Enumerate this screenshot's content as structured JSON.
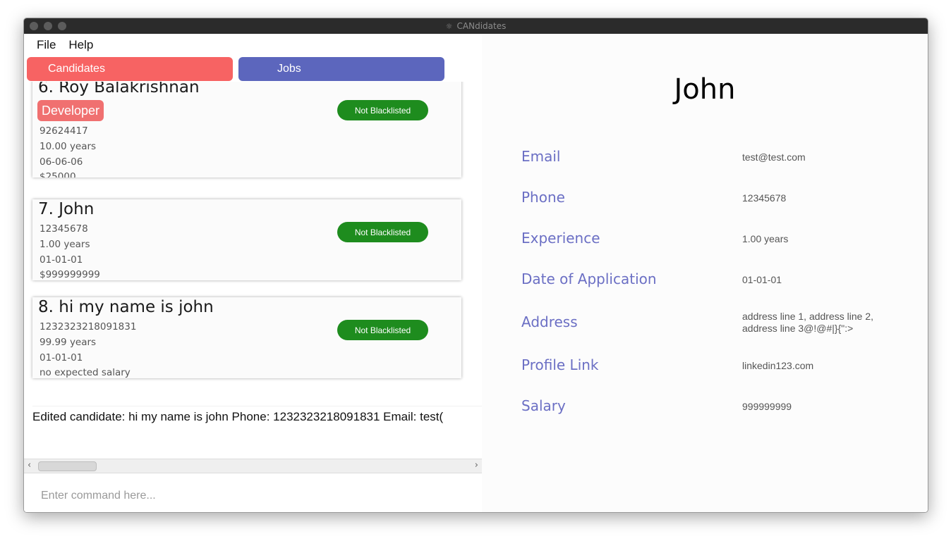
{
  "window": {
    "title": "CANdidates"
  },
  "menu": {
    "file": "File",
    "help": "Help"
  },
  "tabs": {
    "candidates": "Candidates",
    "jobs": "Jobs"
  },
  "candidates": [
    {
      "index": "6.",
      "name": "Roy Balakrishnan",
      "tag": "Developer",
      "phone": "92624417",
      "experience": "10.00 years",
      "date": "06-06-06",
      "salary": "$25000",
      "status": "Not Blacklisted"
    },
    {
      "index": "7.",
      "name": "John",
      "phone": "12345678",
      "experience": "1.00 years",
      "date": "01-01-01",
      "salary": "$999999999",
      "status": "Not Blacklisted"
    },
    {
      "index": "8.",
      "name": "hi my name is john",
      "phone": "1232323218091831",
      "experience": "99.99 years",
      "date": "01-01-01",
      "salary": "no expected salary",
      "status": "Not Blacklisted"
    }
  ],
  "result": {
    "text": "Edited candidate: hi my name is john Phone: 1232323218091831 Email: test("
  },
  "scroll": {
    "left": "‹",
    "right": "›"
  },
  "command": {
    "placeholder": "Enter command here..."
  },
  "detail": {
    "name": "John",
    "fields": [
      {
        "label": "Email",
        "value": "test@test.com"
      },
      {
        "label": "Phone",
        "value": "12345678"
      },
      {
        "label": "Experience",
        "value": "1.00 years"
      },
      {
        "label": "Date of Application",
        "value": "01-01-01"
      },
      {
        "label": "Address",
        "value": "address line 1, address line 2, address line 3@!@#|}{\":>"
      },
      {
        "label": "Profile Link",
        "value": "linkedin123.com"
      },
      {
        "label": "Salary",
        "value": "999999999"
      }
    ]
  },
  "colors": {
    "candidates_tab": "#f76363",
    "jobs_tab": "#5c66bd",
    "status_badge": "#1e8c1e",
    "field_label": "#6b6fc4"
  }
}
